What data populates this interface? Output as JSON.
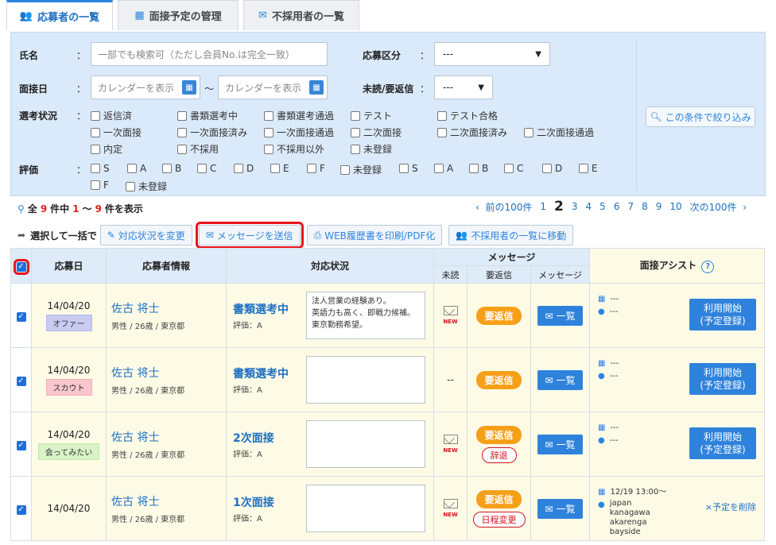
{
  "tabs": [
    {
      "label": "応募者の一覧",
      "icon": "users-icon",
      "active": true
    },
    {
      "label": "面接予定の管理",
      "icon": "calendar-icon",
      "active": false
    },
    {
      "label": "不採用者の一覧",
      "icon": "mail-icon",
      "active": false
    }
  ],
  "search": {
    "name_label": "氏名",
    "name_placeholder": "一部でも検索可（ただし会員No.は完全一致）",
    "app_type_label": "応募区分",
    "app_type_value": "---",
    "interview_label": "面接日",
    "cal_placeholder_from": "カレンダーを表示",
    "cal_placeholder_to": "カレンダーを表示",
    "range_sep": "〜",
    "unread_label": "未読/要返信",
    "unread_value": "---",
    "status_label": "選考状況",
    "status_options": [
      "返信済",
      "書類選考中",
      "書類選考通過",
      "テスト",
      "テスト合格",
      "一次面接",
      "一次面接済み",
      "一次面接通過",
      "二次面接",
      "二次面接済み",
      "二次面接通過",
      "内定",
      "不採用",
      "不採用以外",
      "未登録"
    ],
    "rating_label": "評価",
    "rating_options": [
      "S",
      "A",
      "B",
      "C",
      "D",
      "E",
      "F",
      "未登録",
      "S",
      "A",
      "B",
      "C",
      "D",
      "E",
      "F",
      "未登録"
    ],
    "colon": "：",
    "filter_button": "この条件で絞り込み"
  },
  "result": {
    "prefix": "全",
    "total": "9",
    "mid": "件中",
    "from": "1",
    "sep": "〜",
    "to": "9",
    "suffix": "件を表示"
  },
  "pager": {
    "prev": "前の100件",
    "pages": [
      "1",
      "2",
      "3",
      "4",
      "5",
      "6",
      "7",
      "8",
      "9",
      "10"
    ],
    "current": "2",
    "next": "次の100件"
  },
  "bulk": {
    "label": "選択して一括で",
    "buttons": [
      "対応状況を変更",
      "メッセージを送信",
      "WEB履歴書を印刷/PDF化",
      "不採用者の一覧に移動"
    ]
  },
  "table": {
    "headers": {
      "date": "応募日",
      "info": "応募者情報",
      "status": "対応状況",
      "message": "メッセージ",
      "unread": "未読",
      "reply": "要返信",
      "msg": "メッセージ",
      "assist": "面接アシスト"
    },
    "rows": [
      {
        "date": "14/04/20",
        "tag": "オファー",
        "tag_type": "offer",
        "name": "佐古 将士",
        "sub": "男性 / 26歳 / 東京都",
        "status": "書類選考中",
        "rating": "評価：A",
        "memo": "法人営業の経験あり。\n英語力も高く、即戦力候補。\n東京勤務希望。",
        "unread": "new",
        "reply": "要返信",
        "reply_sub": "",
        "list": "一覧",
        "assist_date": "---",
        "assist_place": "---",
        "assist_btn1": "利用開始",
        "assist_btn2": "(予定登録)"
      },
      {
        "date": "14/04/20",
        "tag": "スカウト",
        "tag_type": "scout",
        "name": "佐古 将士",
        "sub": "男性 / 26歳 / 東京都",
        "status": "書類選考中",
        "rating": "評価：A",
        "memo": "",
        "unread": "--",
        "reply": "要返信",
        "reply_sub": "",
        "list": "一覧",
        "assist_date": "---",
        "assist_place": "---",
        "assist_btn1": "利用開始",
        "assist_btn2": "(予定登録)"
      },
      {
        "date": "14/04/20",
        "tag": "会ってみたい",
        "tag_type": "meet",
        "name": "佐古 将士",
        "sub": "男性 / 26歳 / 東京都",
        "status": "2次面接",
        "rating": "評価：A",
        "memo": "",
        "unread": "new",
        "reply": "要返信",
        "reply_sub": "辞退",
        "list": "一覧",
        "assist_date": "---",
        "assist_place": "---",
        "assist_btn1": "利用開始",
        "assist_btn2": "(予定登録)"
      },
      {
        "date": "14/04/20",
        "tag": "",
        "tag_type": "",
        "name": "佐古 将士",
        "sub": "男性 / 26歳 / 東京都",
        "status": "1次面接",
        "rating": "評価：A",
        "memo": "",
        "unread": "new",
        "reply": "要返信",
        "reply_sub": "日程変更",
        "list": "一覧",
        "assist_date": "12/19 13:00〜",
        "assist_place": "japan kanagawa akarenga bayside",
        "assist_delete": "×予定を削除"
      }
    ]
  },
  "colors": {
    "accent": "#2e82dc",
    "reply": "#f6a019",
    "alert": "#e8141a"
  }
}
